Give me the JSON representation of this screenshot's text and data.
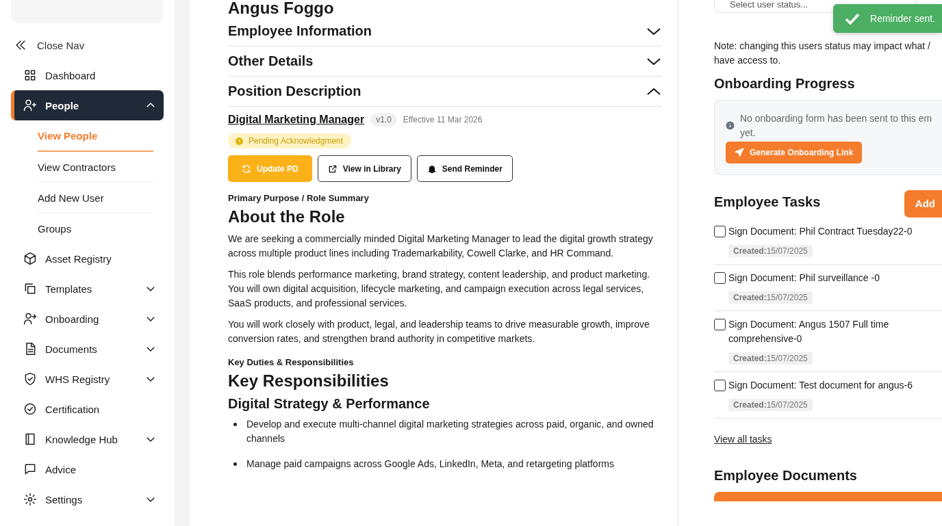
{
  "sidebar": {
    "close_nav": "Close Nav",
    "items": [
      {
        "label": "Dashboard",
        "kind": "link",
        "selected": false
      },
      {
        "label": "People",
        "kind": "group",
        "selected": true,
        "expanded": true,
        "children": [
          {
            "label": "View People",
            "selected": true
          },
          {
            "label": "View Contractors",
            "selected": false
          },
          {
            "label": "Add New User",
            "selected": false
          },
          {
            "label": "Groups",
            "selected": false
          }
        ]
      },
      {
        "label": "Asset Registry",
        "kind": "link",
        "selected": false
      },
      {
        "label": "Templates",
        "kind": "group",
        "selected": false,
        "expanded": false
      },
      {
        "label": "Onboarding",
        "kind": "group",
        "selected": false,
        "expanded": false
      },
      {
        "label": "Documents",
        "kind": "group",
        "selected": false,
        "expanded": false
      },
      {
        "label": "WHS Registry",
        "kind": "group",
        "selected": false,
        "expanded": false
      },
      {
        "label": "Certification",
        "kind": "link",
        "selected": false
      },
      {
        "label": "Knowledge Hub",
        "kind": "group",
        "selected": false,
        "expanded": false
      },
      {
        "label": "Advice",
        "kind": "link",
        "selected": false
      },
      {
        "label": "Settings",
        "kind": "group",
        "selected": false,
        "expanded": false
      }
    ]
  },
  "profile": {
    "name": "Angus Foggo",
    "sections": [
      {
        "title": "Employee Information",
        "expanded": false
      },
      {
        "title": "Other Details",
        "expanded": false
      },
      {
        "title": "Position Description",
        "expanded": true
      }
    ]
  },
  "position_description": {
    "title": "Digital Marketing Manager",
    "version": "v1.0",
    "effective": "Effective 11 Mar 2026",
    "status": "Pending Acknowledgment",
    "buttons": [
      {
        "label": "Update PD",
        "kind": "primary"
      },
      {
        "label": "View in Library",
        "kind": "external"
      },
      {
        "label": "Send Reminder",
        "kind": "bell"
      }
    ],
    "blocks": [
      {
        "kind": "label",
        "text": "Primary Purpose / Role Summary"
      },
      {
        "kind": "h2",
        "text": "About the Role"
      },
      {
        "kind": "p",
        "text": "We are seeking a commercially minded Digital Marketing Manager to lead the digital growth strategy across multiple product lines including Trademarkability, Cowell Clarke, and HR Command."
      },
      {
        "kind": "p",
        "text": "This role blends performance marketing, brand strategy, content leadership, and product marketing. You will own digital acquisition, lifecycle marketing, and campaign execution across legal services, SaaS products, and professional services."
      },
      {
        "kind": "p",
        "text": "You will work closely with product, legal, and leadership teams to drive measurable growth, improve conversion rates, and strengthen brand authority in competitive markets."
      },
      {
        "kind": "label",
        "text": "Key Duties & Responsibilities"
      },
      {
        "kind": "h2",
        "text": "Key Responsibilities"
      },
      {
        "kind": "h3",
        "text": "Digital Strategy & Performance"
      },
      {
        "kind": "bullet",
        "text": "Develop and execute multi-channel digital marketing strategies across paid, organic, and owned channels"
      },
      {
        "kind": "bullet",
        "text": "Manage paid campaigns across Google Ads, LinkedIn, Meta, and retargeting platforms"
      }
    ]
  },
  "status": {
    "placeholder": "Select user status...",
    "note": "Note: changing this users status may impact what / have access to."
  },
  "toast": {
    "message": "Reminder sent."
  },
  "onboarding": {
    "title": "Onboarding Progress",
    "message": "No onboarding form has been sent to this em yet.",
    "button": "Generate Onboarding Link"
  },
  "tasks": {
    "title": "Employee Tasks",
    "add_button": "Add",
    "items": [
      {
        "title": "Sign Document: Phil Contract Tuesday22-0",
        "created": "**Created:**15/07/2025",
        "checked": false
      },
      {
        "title": "Sign Document: Phil surveillance -0",
        "created": "**Created:**15/07/2025",
        "checked": false
      },
      {
        "title": "Sign Document: Angus 1507 Full time comprehensive-0",
        "created": "**Created:**15/07/2025",
        "checked": false
      },
      {
        "title": "Sign Document: Test document for angus-6",
        "created": "**Created:**15/07/2025",
        "checked": false
      }
    ],
    "view_all": "View all tasks"
  },
  "documents": {
    "title": "Employee Documents"
  }
}
